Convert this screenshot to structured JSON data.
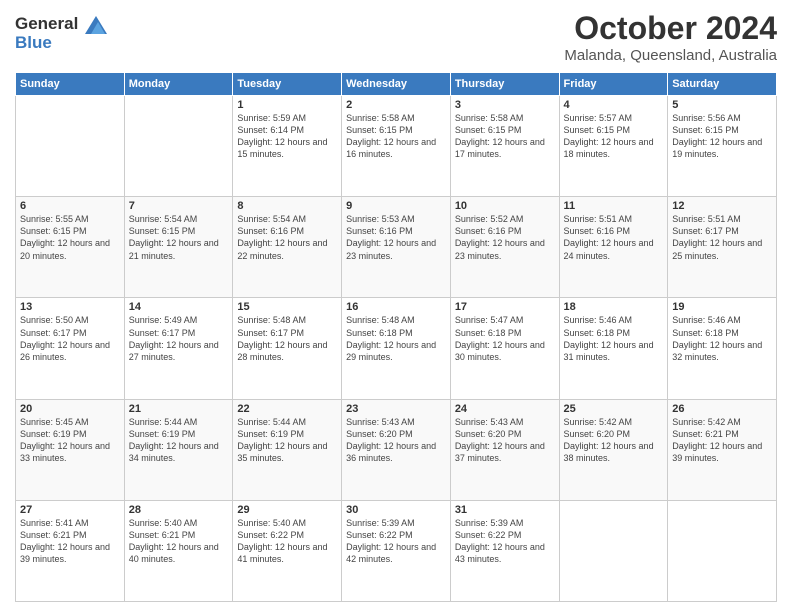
{
  "logo": {
    "line1": "General",
    "line2": "Blue"
  },
  "header": {
    "month": "October 2024",
    "location": "Malanda, Queensland, Australia"
  },
  "weekdays": [
    "Sunday",
    "Monday",
    "Tuesday",
    "Wednesday",
    "Thursday",
    "Friday",
    "Saturday"
  ],
  "weeks": [
    [
      {
        "day": "",
        "sunrise": "",
        "sunset": "",
        "daylight": ""
      },
      {
        "day": "",
        "sunrise": "",
        "sunset": "",
        "daylight": ""
      },
      {
        "day": "1",
        "sunrise": "Sunrise: 5:59 AM",
        "sunset": "Sunset: 6:14 PM",
        "daylight": "Daylight: 12 hours and 15 minutes."
      },
      {
        "day": "2",
        "sunrise": "Sunrise: 5:58 AM",
        "sunset": "Sunset: 6:15 PM",
        "daylight": "Daylight: 12 hours and 16 minutes."
      },
      {
        "day": "3",
        "sunrise": "Sunrise: 5:58 AM",
        "sunset": "Sunset: 6:15 PM",
        "daylight": "Daylight: 12 hours and 17 minutes."
      },
      {
        "day": "4",
        "sunrise": "Sunrise: 5:57 AM",
        "sunset": "Sunset: 6:15 PM",
        "daylight": "Daylight: 12 hours and 18 minutes."
      },
      {
        "day": "5",
        "sunrise": "Sunrise: 5:56 AM",
        "sunset": "Sunset: 6:15 PM",
        "daylight": "Daylight: 12 hours and 19 minutes."
      }
    ],
    [
      {
        "day": "6",
        "sunrise": "Sunrise: 5:55 AM",
        "sunset": "Sunset: 6:15 PM",
        "daylight": "Daylight: 12 hours and 20 minutes."
      },
      {
        "day": "7",
        "sunrise": "Sunrise: 5:54 AM",
        "sunset": "Sunset: 6:15 PM",
        "daylight": "Daylight: 12 hours and 21 minutes."
      },
      {
        "day": "8",
        "sunrise": "Sunrise: 5:54 AM",
        "sunset": "Sunset: 6:16 PM",
        "daylight": "Daylight: 12 hours and 22 minutes."
      },
      {
        "day": "9",
        "sunrise": "Sunrise: 5:53 AM",
        "sunset": "Sunset: 6:16 PM",
        "daylight": "Daylight: 12 hours and 23 minutes."
      },
      {
        "day": "10",
        "sunrise": "Sunrise: 5:52 AM",
        "sunset": "Sunset: 6:16 PM",
        "daylight": "Daylight: 12 hours and 23 minutes."
      },
      {
        "day": "11",
        "sunrise": "Sunrise: 5:51 AM",
        "sunset": "Sunset: 6:16 PM",
        "daylight": "Daylight: 12 hours and 24 minutes."
      },
      {
        "day": "12",
        "sunrise": "Sunrise: 5:51 AM",
        "sunset": "Sunset: 6:17 PM",
        "daylight": "Daylight: 12 hours and 25 minutes."
      }
    ],
    [
      {
        "day": "13",
        "sunrise": "Sunrise: 5:50 AM",
        "sunset": "Sunset: 6:17 PM",
        "daylight": "Daylight: 12 hours and 26 minutes."
      },
      {
        "day": "14",
        "sunrise": "Sunrise: 5:49 AM",
        "sunset": "Sunset: 6:17 PM",
        "daylight": "Daylight: 12 hours and 27 minutes."
      },
      {
        "day": "15",
        "sunrise": "Sunrise: 5:48 AM",
        "sunset": "Sunset: 6:17 PM",
        "daylight": "Daylight: 12 hours and 28 minutes."
      },
      {
        "day": "16",
        "sunrise": "Sunrise: 5:48 AM",
        "sunset": "Sunset: 6:18 PM",
        "daylight": "Daylight: 12 hours and 29 minutes."
      },
      {
        "day": "17",
        "sunrise": "Sunrise: 5:47 AM",
        "sunset": "Sunset: 6:18 PM",
        "daylight": "Daylight: 12 hours and 30 minutes."
      },
      {
        "day": "18",
        "sunrise": "Sunrise: 5:46 AM",
        "sunset": "Sunset: 6:18 PM",
        "daylight": "Daylight: 12 hours and 31 minutes."
      },
      {
        "day": "19",
        "sunrise": "Sunrise: 5:46 AM",
        "sunset": "Sunset: 6:18 PM",
        "daylight": "Daylight: 12 hours and 32 minutes."
      }
    ],
    [
      {
        "day": "20",
        "sunrise": "Sunrise: 5:45 AM",
        "sunset": "Sunset: 6:19 PM",
        "daylight": "Daylight: 12 hours and 33 minutes."
      },
      {
        "day": "21",
        "sunrise": "Sunrise: 5:44 AM",
        "sunset": "Sunset: 6:19 PM",
        "daylight": "Daylight: 12 hours and 34 minutes."
      },
      {
        "day": "22",
        "sunrise": "Sunrise: 5:44 AM",
        "sunset": "Sunset: 6:19 PM",
        "daylight": "Daylight: 12 hours and 35 minutes."
      },
      {
        "day": "23",
        "sunrise": "Sunrise: 5:43 AM",
        "sunset": "Sunset: 6:20 PM",
        "daylight": "Daylight: 12 hours and 36 minutes."
      },
      {
        "day": "24",
        "sunrise": "Sunrise: 5:43 AM",
        "sunset": "Sunset: 6:20 PM",
        "daylight": "Daylight: 12 hours and 37 minutes."
      },
      {
        "day": "25",
        "sunrise": "Sunrise: 5:42 AM",
        "sunset": "Sunset: 6:20 PM",
        "daylight": "Daylight: 12 hours and 38 minutes."
      },
      {
        "day": "26",
        "sunrise": "Sunrise: 5:42 AM",
        "sunset": "Sunset: 6:21 PM",
        "daylight": "Daylight: 12 hours and 39 minutes."
      }
    ],
    [
      {
        "day": "27",
        "sunrise": "Sunrise: 5:41 AM",
        "sunset": "Sunset: 6:21 PM",
        "daylight": "Daylight: 12 hours and 39 minutes."
      },
      {
        "day": "28",
        "sunrise": "Sunrise: 5:40 AM",
        "sunset": "Sunset: 6:21 PM",
        "daylight": "Daylight: 12 hours and 40 minutes."
      },
      {
        "day": "29",
        "sunrise": "Sunrise: 5:40 AM",
        "sunset": "Sunset: 6:22 PM",
        "daylight": "Daylight: 12 hours and 41 minutes."
      },
      {
        "day": "30",
        "sunrise": "Sunrise: 5:39 AM",
        "sunset": "Sunset: 6:22 PM",
        "daylight": "Daylight: 12 hours and 42 minutes."
      },
      {
        "day": "31",
        "sunrise": "Sunrise: 5:39 AM",
        "sunset": "Sunset: 6:22 PM",
        "daylight": "Daylight: 12 hours and 43 minutes."
      },
      {
        "day": "",
        "sunrise": "",
        "sunset": "",
        "daylight": ""
      },
      {
        "day": "",
        "sunrise": "",
        "sunset": "",
        "daylight": ""
      }
    ]
  ]
}
